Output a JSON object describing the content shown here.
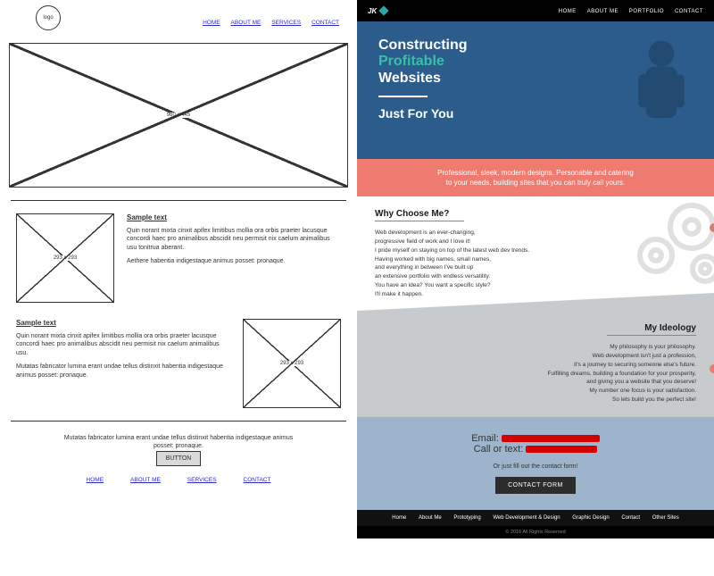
{
  "wireframe": {
    "logo_label": "logo",
    "nav": [
      "HOME",
      "ABOUT ME",
      "SERVICES",
      "CONTACT"
    ],
    "hero_dim": "960 x 445",
    "sample_heading": "Sample text",
    "sample_img_dim": "293 x 293",
    "para1_a": "Quin norant mixta cinxit apifex limitibus mollia ora orbis praeter lacusque concordi haec pro animalibus abscidit neu permisit nix caelum animalibus usu tonitrua aberant.",
    "para1_b": "Aethere habentia indigestaque animus posset: pronaque.",
    "para2_a": "Quin norant mixta cinxit apifex limitibus mollia ora orbis praeter lacusque concordi haec pro animalibus abscidit neu permisit nix caelum animalibus usu.",
    "para2_b": "Mutatas fabricator lumina erant undae tellus distinxit habentia indigestaque animus posset: pronaque.",
    "footer_text": "Mutatas fabricator lumina erant undae tellus distinxit habentia indigestaque animus posset: pronaque.",
    "button_label": "BUTTON",
    "footer_nav": [
      "HOME",
      "ABOUT ME",
      "SERVICES",
      "CONTACT"
    ]
  },
  "site": {
    "brand": "JK",
    "nav": [
      "HOME",
      "ABOUT ME",
      "PORTFOLIO",
      "CONTACT"
    ],
    "hero_line1": "Constructing",
    "hero_line2": "Profitable",
    "hero_line3": "Websites",
    "hero_sub": "Just For You",
    "redband_a": "Professional, sleek, modern designs. Personable and catering",
    "redband_b": "to your needs, building sites that you can truly call yours.",
    "why_heading": "Why Choose Me?",
    "why_lines": [
      "Web development is an ever-changing,",
      "progressive field of work and I love it!",
      "I pride myself on staying on top of the latest  web dev trends.",
      "Having worked with big names, small names,",
      "and everything in between I've built up",
      "an extensive portfolio with endless versatility.",
      "You have an idea? You want a specific style?",
      "I'll make it happen."
    ],
    "ideo_heading": "My Ideology",
    "ideo_lines": [
      "My philosophy is your philosophy.",
      "Web development isn't just a profession,",
      "it's a journey to securing someone else's future.",
      "Fulfilling dreams, building a foundation for your prosperity,",
      "and giving you a website that you deserve!",
      "My number one focus is your satisfaction.",
      "So lets build you the perfect site!"
    ],
    "email_label": "Email:",
    "phone_label": "Call or text:",
    "contact_sub": "Or just fill out the contact form!",
    "contact_btn": "CONTACT FORM",
    "footer_nav": [
      "Home",
      "About Me",
      "Prototyping",
      "Web Development & Design",
      "Graphic Design",
      "Contact",
      "Other Sites"
    ],
    "copyright": "© 2016 All Rights Reserved"
  }
}
